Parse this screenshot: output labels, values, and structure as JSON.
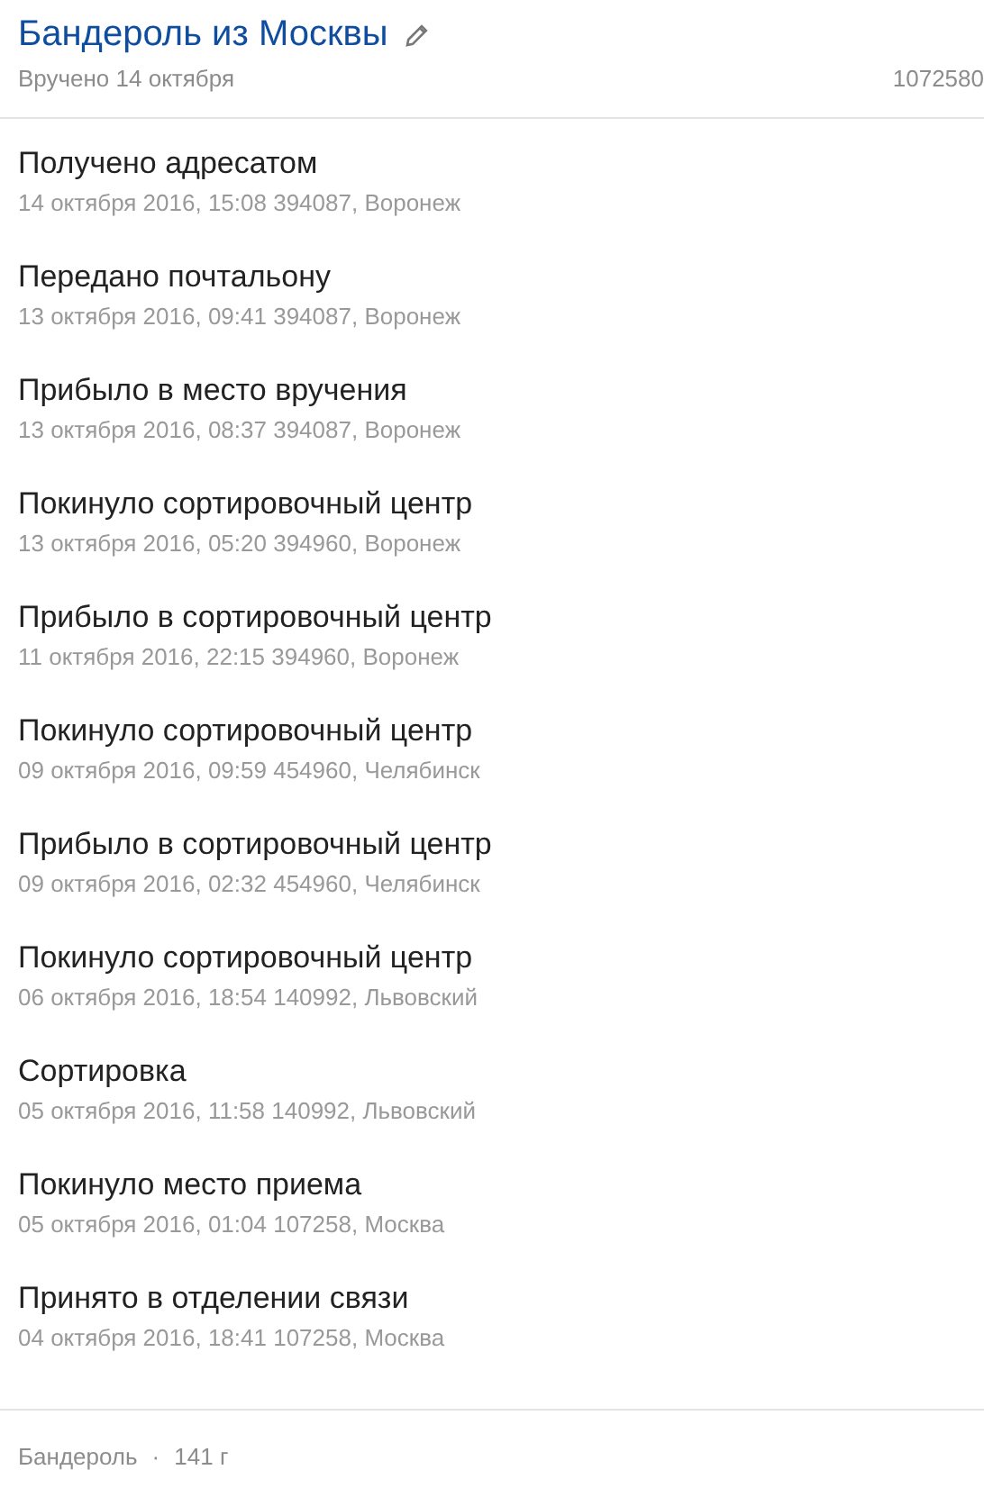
{
  "header": {
    "title": "Бандероль из Москвы",
    "status": "Вручено 14 октября",
    "tracking_number": "1072580"
  },
  "events": [
    {
      "title": "Получено адресатом",
      "details": "14 октября 2016, 15:08 394087, Воронеж"
    },
    {
      "title": "Передано почтальону",
      "details": "13 октября 2016, 09:41 394087, Воронеж"
    },
    {
      "title": "Прибыло в место вручения",
      "details": "13 октября 2016, 08:37 394087, Воронеж"
    },
    {
      "title": "Покинуло сортировочный центр",
      "details": "13 октября 2016, 05:20 394960, Воронеж"
    },
    {
      "title": "Прибыло в сортировочный центр",
      "details": "11 октября 2016, 22:15 394960, Воронеж"
    },
    {
      "title": "Покинуло сортировочный центр",
      "details": "09 октября 2016, 09:59 454960, Челябинск"
    },
    {
      "title": "Прибыло в сортировочный центр",
      "details": "09 октября 2016, 02:32 454960, Челябинск"
    },
    {
      "title": "Покинуло сортировочный центр",
      "details": "06 октября 2016, 18:54 140992, Львовский"
    },
    {
      "title": "Сортировка",
      "details": "05 октября 2016, 11:58 140992, Львовский"
    },
    {
      "title": "Покинуло место приема",
      "details": "05 октября 2016, 01:04 107258, Москва"
    },
    {
      "title": "Принято в отделении связи",
      "details": "04 октября 2016, 18:41 107258, Москва"
    }
  ],
  "footer": {
    "type": "Бандероль",
    "separator": "·",
    "weight": "141 г"
  }
}
